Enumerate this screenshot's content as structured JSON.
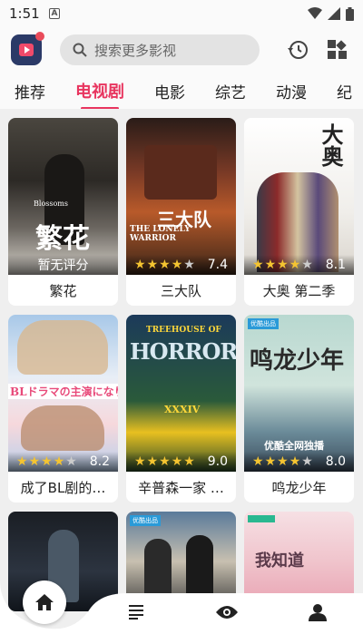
{
  "status": {
    "time": "1:51",
    "badge": "A"
  },
  "search": {
    "placeholder": "搜索更多影视"
  },
  "tabs": [
    {
      "label": "推荐"
    },
    {
      "label": "电视剧"
    },
    {
      "label": "电影"
    },
    {
      "label": "综艺"
    },
    {
      "label": "动漫"
    },
    {
      "label": "纪"
    }
  ],
  "cards": [
    {
      "title": "繁花",
      "score_text": "暂无评分",
      "poster_text": "繁花",
      "poster_sub": "Blossoms"
    },
    {
      "title": "三大队",
      "score": "7.4",
      "stars": 3.5,
      "poster_text": "三大队",
      "poster_sub": "THE LONELY WARRIOR"
    },
    {
      "title": "大奥 第二季",
      "score": "8.1",
      "stars": 4,
      "poster_text": "大奥"
    },
    {
      "title": "成了BL剧的…",
      "score": "8.2",
      "stars": 4,
      "poster_text": "BLドラマの主演になりました"
    },
    {
      "title": "辛普森一家 …",
      "score": "9.0",
      "stars": 4.5,
      "poster_text": "HORROR",
      "poster_sub": "TREEHOUSE OF",
      "poster_num": "XXXIV"
    },
    {
      "title": "鸣龙少年",
      "score": "8.0",
      "stars": 4,
      "poster_text": "鸣龙少年",
      "poster_tag": "优酷全网独播",
      "poster_badge": "优酷出品"
    },
    {
      "title": "",
      "poster_text": ""
    },
    {
      "title": "",
      "poster_badge": "优酷出品"
    },
    {
      "title": "",
      "poster_text": "我知道"
    }
  ]
}
